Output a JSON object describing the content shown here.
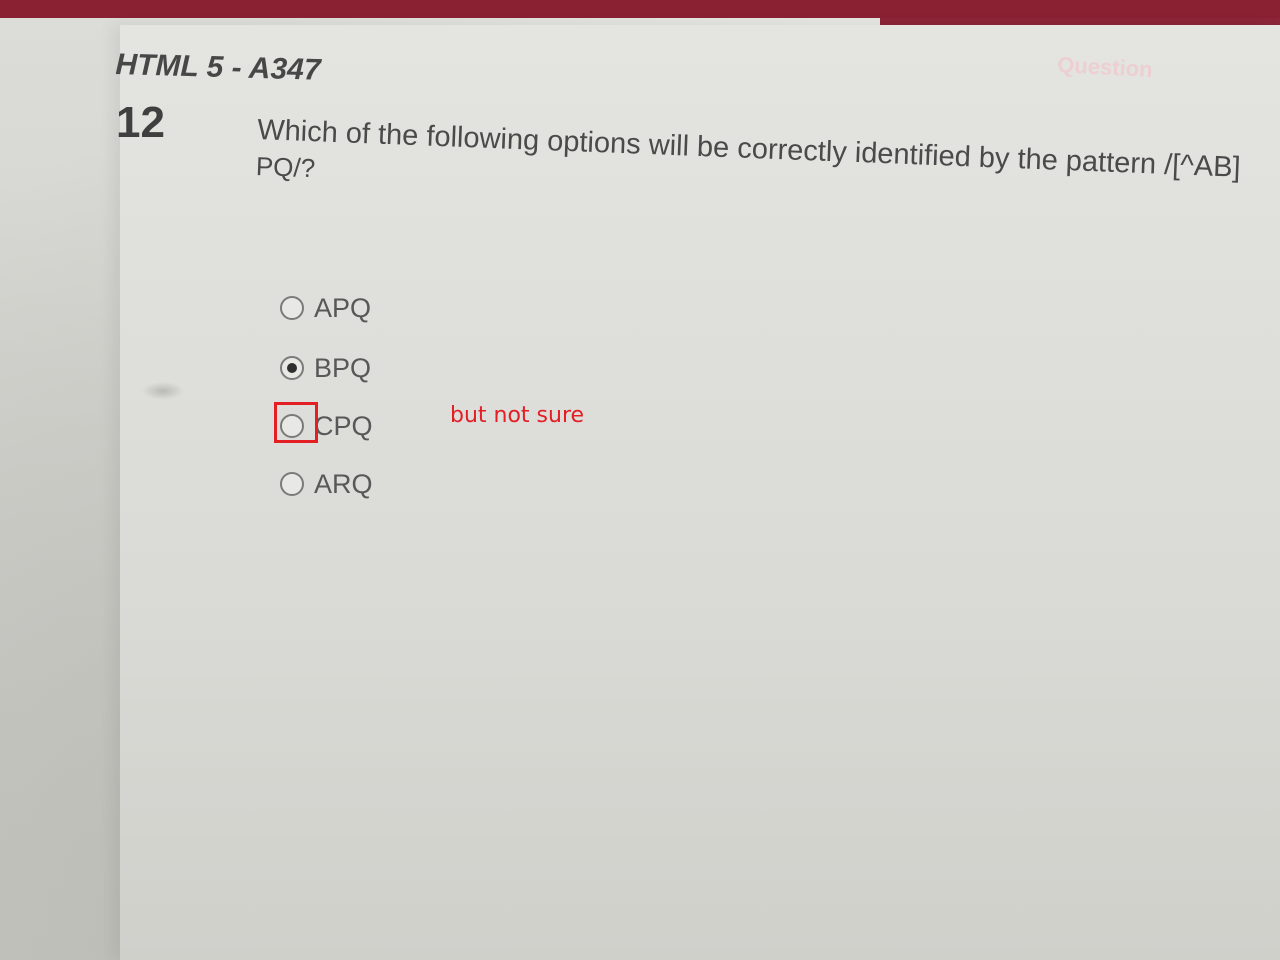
{
  "header": {
    "test_title": "HTML 5 - A347",
    "ribbon_label": "Question"
  },
  "question": {
    "number": "12",
    "text_line1": "Which of the following options will be correctly identified by the pattern /[^AB]",
    "text_line2": "PQ/?"
  },
  "options": [
    {
      "label": "APQ",
      "selected": false
    },
    {
      "label": "BPQ",
      "selected": true
    },
    {
      "label": "CPQ",
      "selected": false
    },
    {
      "label": "ARQ",
      "selected": false
    }
  ],
  "annotation": {
    "text": "but not sure",
    "color": "#e31e24",
    "highlighted_option": "CPQ"
  },
  "colors": {
    "brand_bar": "#8a2133",
    "background": "#d8d8d4",
    "text": "#4a4a4a"
  }
}
